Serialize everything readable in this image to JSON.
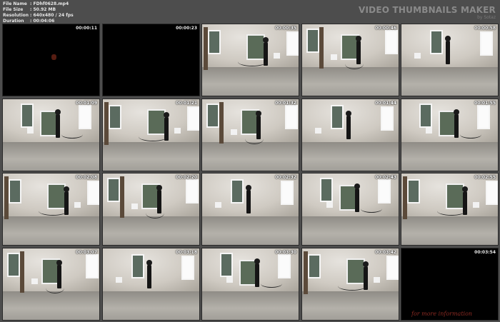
{
  "meta": {
    "rows": [
      {
        "key": "File Name",
        "value": ": FDhf0628.mp4"
      },
      {
        "key": "File Size",
        "value": ": 50.92 MB"
      },
      {
        "key": "Resolution",
        "value": ": 640x480 / 24 fps"
      },
      {
        "key": "Duration",
        "value": ": 00:04:06"
      }
    ]
  },
  "brand": {
    "name": "VIDEO THUMBNAILS MAKER",
    "sub": "by Sotaz"
  },
  "thumbnails": [
    {
      "time": "00:00:11",
      "dark": true
    },
    {
      "time": "00:00:23",
      "dark": true
    },
    {
      "time": "00:00:35",
      "dark": false
    },
    {
      "time": "00:00:46",
      "dark": false
    },
    {
      "time": "00:00:58",
      "dark": false
    },
    {
      "time": "00:01:09",
      "dark": false
    },
    {
      "time": "00:01:21",
      "dark": false
    },
    {
      "time": "00:01:32",
      "dark": false
    },
    {
      "time": "00:01:44",
      "dark": false
    },
    {
      "time": "00:01:55",
      "dark": false
    },
    {
      "time": "00:02:08",
      "dark": false
    },
    {
      "time": "00:02:20",
      "dark": false
    },
    {
      "time": "00:02:32",
      "dark": false
    },
    {
      "time": "00:02:43",
      "dark": false
    },
    {
      "time": "00:02:55",
      "dark": false
    },
    {
      "time": "00:03:07",
      "dark": false
    },
    {
      "time": "00:03:18",
      "dark": false
    },
    {
      "time": "00:03:30",
      "dark": false
    },
    {
      "time": "00:03:42",
      "dark": false
    },
    {
      "time": "00:03:54",
      "dark": true
    }
  ],
  "promo": "for more information"
}
